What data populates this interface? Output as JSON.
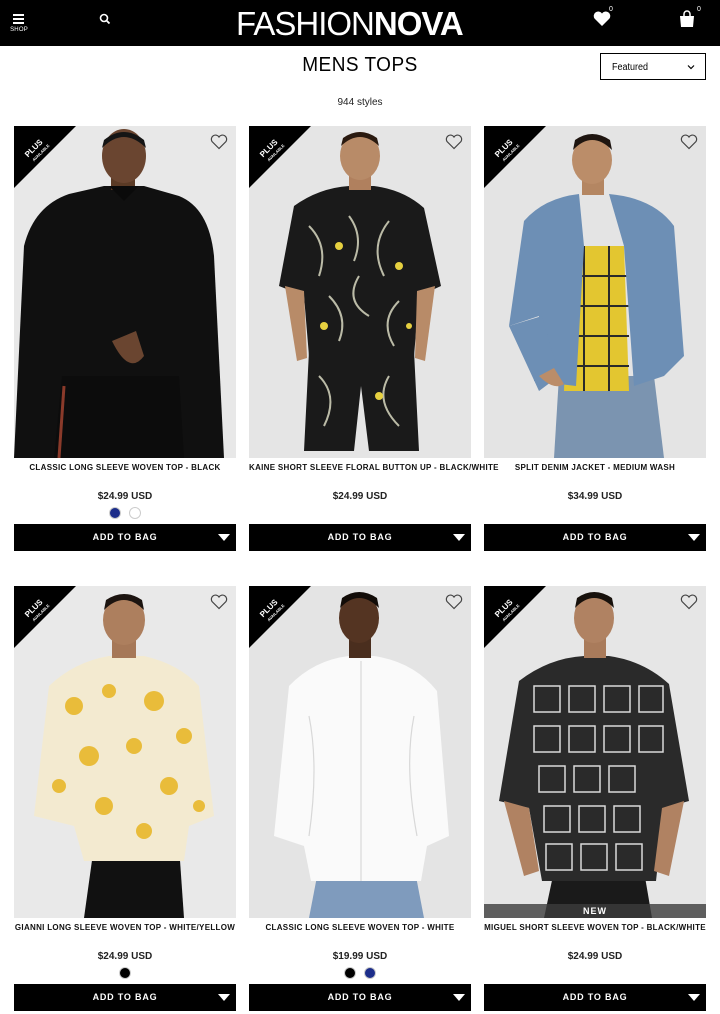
{
  "header": {
    "shop_label": "SHOP",
    "logo_light": "FASHION",
    "logo_bold": "NOVA",
    "wishlist_count": "0",
    "bag_count": "0"
  },
  "page": {
    "title": "MENS TOPS",
    "style_count": "944 styles",
    "sort_value": "Featured"
  },
  "badge": {
    "line1": "PLUS",
    "line2": "AVAILABLE"
  },
  "products": [
    {
      "name": "CLASSIC LONG SLEEVE WOVEN TOP - BLACK",
      "price": "$24.99 USD",
      "add_to_bag": "ADD TO BAG",
      "new_label": "",
      "swatches": [
        "#1c2d8a",
        "#ffffff"
      ]
    },
    {
      "name": "KAINE SHORT SLEEVE FLORAL BUTTON UP - BLACK/WHITE",
      "price": "$24.99 USD",
      "add_to_bag": "ADD TO BAG",
      "new_label": "",
      "swatches": []
    },
    {
      "name": "SPLIT DENIM JACKET - MEDIUM WASH",
      "price": "$34.99 USD",
      "add_to_bag": "ADD TO BAG",
      "new_label": "",
      "swatches": []
    },
    {
      "name": "GIANNI LONG SLEEVE WOVEN TOP - WHITE/YELLOW",
      "price": "$24.99 USD",
      "add_to_bag": "ADD TO BAG",
      "new_label": "",
      "swatches": [
        "#000000"
      ]
    },
    {
      "name": "CLASSIC LONG SLEEVE WOVEN TOP - WHITE",
      "price": "$19.99 USD",
      "add_to_bag": "ADD TO BAG",
      "new_label": "",
      "swatches": [
        "#000000",
        "#1c2d8a"
      ]
    },
    {
      "name": "MIGUEL SHORT SLEEVE WOVEN TOP - BLACK/WHITE",
      "price": "$24.99 USD",
      "add_to_bag": "ADD TO BAG",
      "new_label": "NEW",
      "swatches": []
    }
  ]
}
